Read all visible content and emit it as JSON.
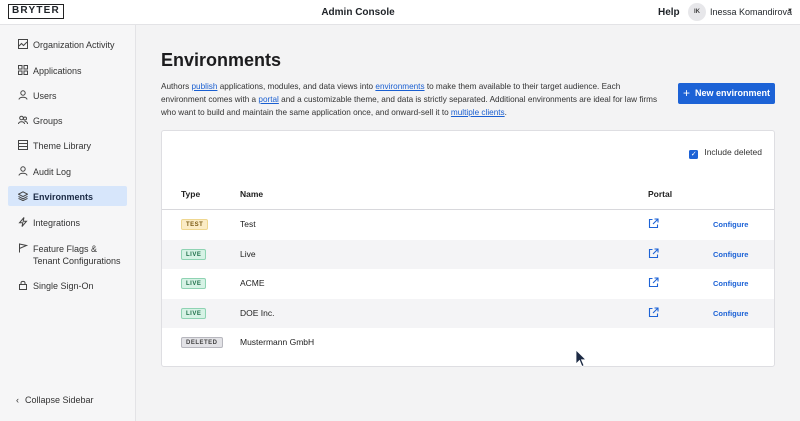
{
  "header": {
    "logo": "BRYTER",
    "title": "Admin Console",
    "help": "Help",
    "user_initials": "IK",
    "user_name": "Inessa Komandirova"
  },
  "sidebar": {
    "items": [
      {
        "label": "Organization Activity",
        "icon": "activity-icon"
      },
      {
        "label": "Applications",
        "icon": "grid-icon"
      },
      {
        "label": "Users",
        "icon": "user-icon"
      },
      {
        "label": "Groups",
        "icon": "users-icon"
      },
      {
        "label": "Theme Library",
        "icon": "book-icon"
      },
      {
        "label": "Audit Log",
        "icon": "audit-icon"
      },
      {
        "label": "Environments",
        "icon": "layers-icon",
        "active": true
      },
      {
        "label": "Integrations",
        "icon": "bolt-icon"
      },
      {
        "label": "Feature Flags & Tenant Configurations",
        "icon": "flag-icon"
      },
      {
        "label": "Single Sign-On",
        "icon": "lock-icon"
      }
    ],
    "collapse_label": "Collapse Sidebar"
  },
  "main": {
    "title": "Environments",
    "intro": {
      "t1": "Authors ",
      "link_publish": "publish",
      "t2": " applications, modules, and data views into ",
      "link_environments": "environments",
      "t3": " to make them available to their target audience. Each environment comes with a ",
      "link_portal": "portal",
      "t4": " and a customizable theme, and data is strictly separated. Additional environments are ideal for law firms who want to build and maintain the same application once, and onward-sell it to ",
      "link_clients": "multiple clients",
      "t5": "."
    },
    "new_button": "New environment",
    "include_deleted_label": "Include deleted",
    "include_deleted_checked": true,
    "table": {
      "headers": {
        "type": "Type",
        "name": "Name",
        "portal": "Portal"
      },
      "configure_label": "Configure",
      "rows": [
        {
          "type": "TEST",
          "name": "Test",
          "has_portal": true,
          "configurable": true
        },
        {
          "type": "LIVE",
          "name": "Live",
          "has_portal": true,
          "configurable": true
        },
        {
          "type": "LIVE",
          "name": "ACME",
          "has_portal": true,
          "configurable": true
        },
        {
          "type": "LIVE",
          "name": "DOE Inc.",
          "has_portal": true,
          "configurable": true
        },
        {
          "type": "DELETED",
          "name": "Mustermann GmbH",
          "has_portal": false,
          "configurable": false
        }
      ]
    }
  },
  "colors": {
    "primary": "#1c62d6",
    "active_nav": "#d7e6fb",
    "badge_test": "#fbecc5",
    "badge_live": "#d6f2e5",
    "badge_deleted": "#e2e2e6"
  }
}
